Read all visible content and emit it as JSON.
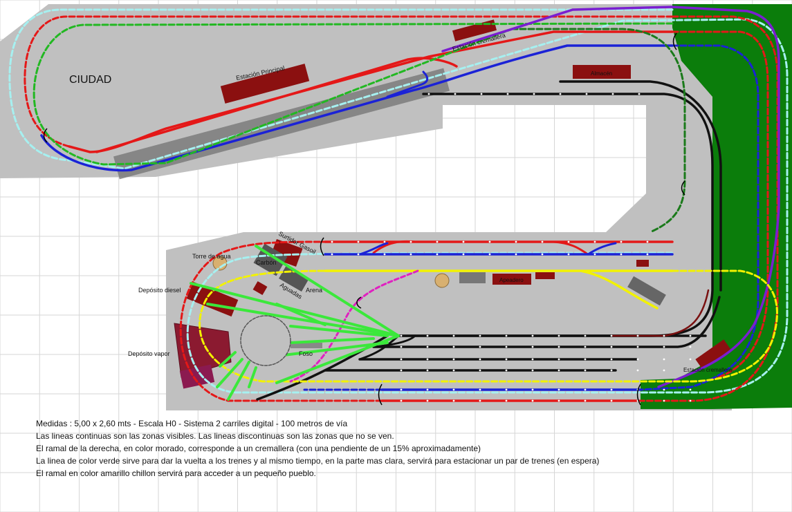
{
  "labels": {
    "city": "CIUDAD",
    "main_station": "Estación Principal",
    "rack_station_top": "Estación cremallera",
    "warehouse": "Almacén",
    "gasoil": "Surtidor Gasoil",
    "water_tower": "Torre de agua",
    "coal": "Carbón",
    "sand": "Arena",
    "water": "Aguadas",
    "diesel_depot": "Depósito diesel",
    "steam_depot": "Depósito vapor",
    "pit": "Foso",
    "halt": "Apeadero",
    "rack_station_bottom": "Estación cremallera"
  },
  "notes": {
    "line1": "Medidas :  5,00  x  2,60  mts   -  Escala  H0   -   Sistema  2 carriles digital   -    100 metros de vía",
    "line2": "Las lineas continuas son las zonas visibles.    Las lineas discontinuas son las zonas que no se ven.",
    "line3": "El ramal de la derecha, en color morado, corresponde a un cremallera (con una pendiente de un 15% aproximadamente)",
    "line4": "La linea de color verde sirve para dar la vuelta a los trenes y al mismo tiempo, en la parte mas clara, servirá para estacionar un par de trenes (en espera)",
    "line5": "El ramal en color amarillo chillon servirá para acceder a un pequeño pueblo."
  },
  "colors": {
    "board": "#c0c0c0",
    "grass": "#0b7d0b",
    "building": "#8b1010",
    "red": "#e41818",
    "blue": "#1b22d6",
    "black": "#111111",
    "cyan": "#a6f0f0",
    "green": "#22b822",
    "lightgreen": "#3be83b",
    "darkgreen": "#1a7a1a",
    "purple": "#7a1ed0",
    "yellow": "#f2f200",
    "magenta": "#e020c0"
  }
}
